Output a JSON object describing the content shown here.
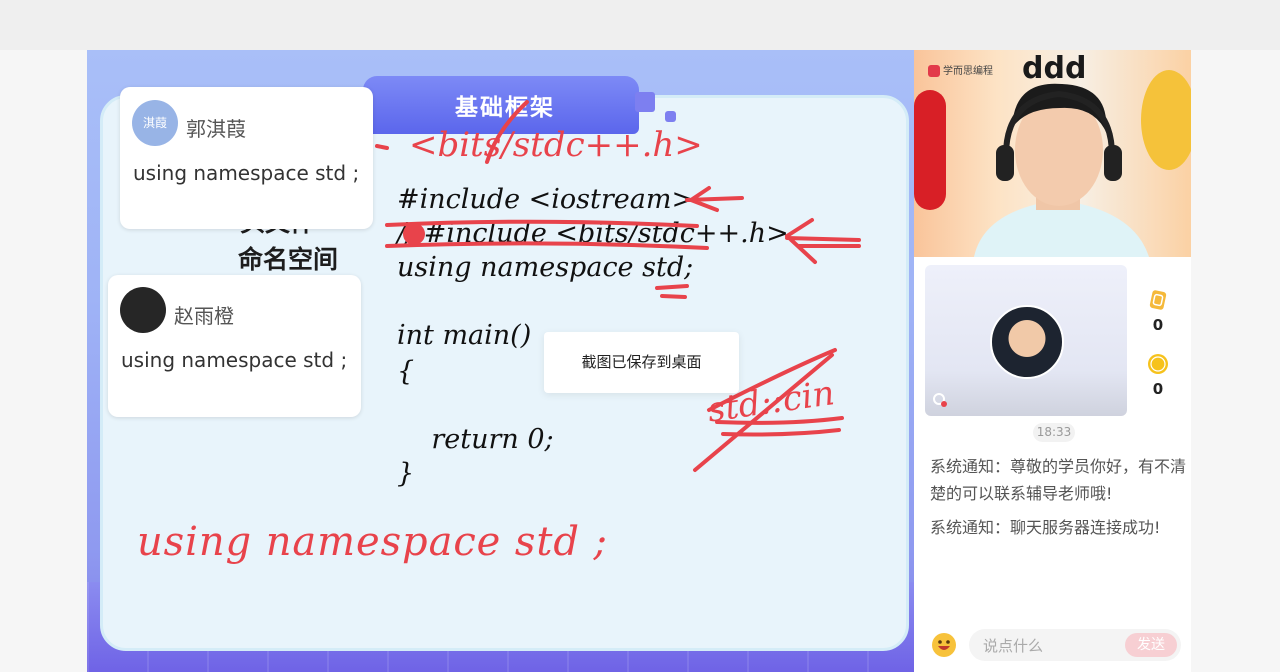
{
  "slide": {
    "title": "基础框架",
    "label_top": "头文件",
    "label": "命名空间",
    "code": [
      "#include <iostream>",
      "// #include <bits/stdc++.h>",
      "using namespace std;",
      "",
      "int main()",
      "{",
      "",
      "    return 0;",
      "}"
    ],
    "annotations": {
      "top_scribble": "<bits/stdc++.h>",
      "right_scribble": "std::cin",
      "bottom_scribble": "using namespace std ;"
    }
  },
  "bubbles": [
    {
      "avatar_text": "淇葭",
      "name": "郭淇葭",
      "message": "using   namespace   std ;"
    },
    {
      "name": "赵雨橙",
      "message": "using namespace    std ;"
    }
  ],
  "toast": "截图已保存到桌面",
  "panel": {
    "brand": "学而思编程",
    "stats": [
      {
        "icon": "card-icon",
        "value": "0"
      },
      {
        "icon": "gold-coin-icon",
        "value": "0"
      }
    ],
    "time": "18:33",
    "messages": [
      "系统通知：尊敬的学员你好，有不清楚的可以联系辅导老师哦!",
      "系统通知：聊天服务器连接成功!"
    ],
    "input_placeholder": "说点什么",
    "send_label": "发送"
  },
  "colors": {
    "accent": "#5b66ec",
    "annotation": "#e8434b",
    "send": "#f7cfd3"
  }
}
